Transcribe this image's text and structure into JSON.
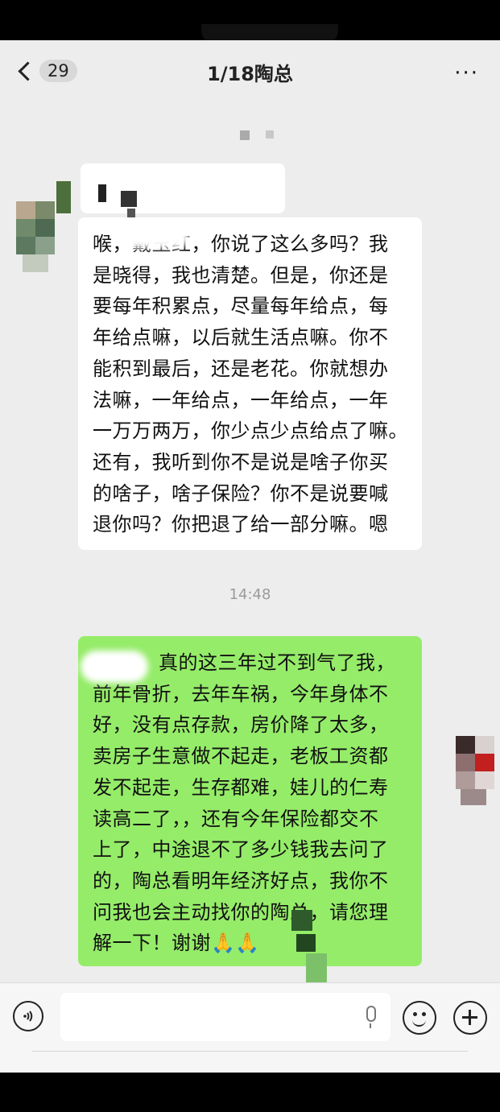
{
  "header": {
    "unread_count": "29",
    "title": "1/18陶总",
    "more_label": "···"
  },
  "messages": {
    "incoming": {
      "lines": [
        "喉，戴玉红，你说了这么多吗？我",
        "是晓得，我也清楚。但是，你还是",
        "要每年积累点，尽量每年给点，每",
        "年给点嘛，以后就生活点嘛。你不",
        "能积到最后，还是老花。你就想办",
        "法嘛，一年给点，一年给点，一年",
        "一万万两万，你少点少点给点了嘛。",
        "还有，我听到你不是说是啥子你买",
        "的啥子，啥子保险？你不是说要喊",
        "退你吗？你把退了给一部分嘛。嗯"
      ]
    },
    "timestamp": "14:48",
    "outgoing": {
      "lines": [
        "真的这三年过不到气了我，",
        "前年骨折，去年车祸，今年身体不",
        "好，没有点存款，房价降了太多，",
        "卖房子生意做不起走，老板工资都",
        "发不起走，生存都难，娃儿的仁寿",
        "读高二了，，还有今年保险都交不",
        "上了，中途退不了多少钱我去问了",
        "的，陶总看明年经济好点，我你不",
        "问我也会主动找你的陶总，请您理",
        "解一下！谢谢🙏🙏"
      ]
    }
  },
  "composer": {
    "voice_icon": "voice-icon",
    "mic_icon": "mic-icon",
    "emoji_icon": "emoji-icon",
    "plus_icon": "plus-icon"
  }
}
